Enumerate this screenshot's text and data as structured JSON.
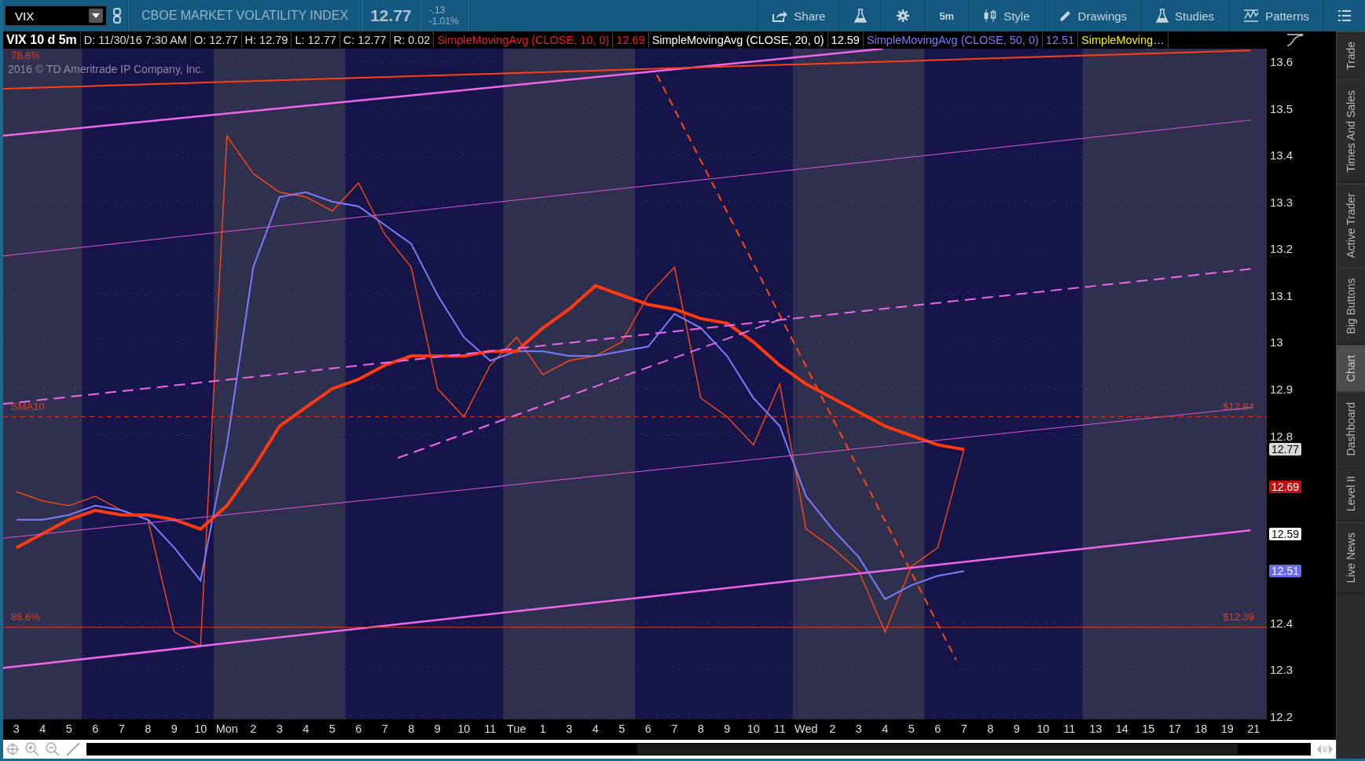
{
  "toolbar": {
    "symbol": "VIX",
    "description": "CBOE MARKET VOLATILITY INDEX",
    "last": "12.77",
    "change": "-.13",
    "change_percent": "-1.01%",
    "buttons": [
      {
        "kind": "share",
        "label": "Share"
      },
      {
        "kind": "flask"
      },
      {
        "kind": "gear"
      },
      {
        "kind": "text",
        "label": "5m"
      },
      {
        "kind": "style",
        "label": "Style"
      },
      {
        "kind": "drawings",
        "label": "Drawings"
      },
      {
        "kind": "studies",
        "label": "Studies"
      },
      {
        "kind": "patterns",
        "label": "Patterns"
      },
      {
        "kind": "menu"
      }
    ]
  },
  "legend": {
    "title": "VIX 10 d 5m",
    "fields": [
      "D: 11/30/16 7:30 AM",
      "O: 12.77",
      "H: 12.79",
      "L: 12.77",
      "C: 12.77",
      "R: 0.02"
    ],
    "studies": [
      {
        "label": "SimpleMovingAvg (CLOSE, 10, 0)",
        "value": "12.69"
      },
      {
        "label": "SimpleMovingAvg (CLOSE, 20, 0)",
        "value": "12.59"
      },
      {
        "label": "SimpleMovingAvg (CLOSE, 50, 0)",
        "value": "12.51"
      },
      {
        "label": "SimpleMoving…"
      }
    ]
  },
  "chart": {
    "copyright": "2016 © TD Ameritrade IP Company, Inc.",
    "top_level_label": "78.6%",
    "chart_data": {
      "type": "line",
      "categories": [
        "3",
        "4",
        "5",
        "6",
        "7",
        "8",
        "9",
        "10",
        "Mon",
        "2",
        "3",
        "4",
        "5",
        "6",
        "7",
        "8",
        "9",
        "10",
        "11",
        "Tue",
        "1",
        "3",
        "4",
        "5",
        "6",
        "7",
        "8",
        "9",
        "10",
        "11",
        "Wed",
        "2",
        "3",
        "4",
        "5",
        "6",
        "7",
        "8",
        "9",
        "10",
        "11",
        "13",
        "14",
        "15",
        "17",
        "18",
        "19",
        "21"
      ],
      "ylim": [
        12.193,
        13.627
      ],
      "yticks": [
        12.2,
        12.3,
        12.4,
        12.8,
        12.9,
        13,
        13.1,
        13.2,
        13.3,
        13.4,
        13.5,
        13.6
      ],
      "series": [
        {
          "color": "#ff4a12",
          "values": [
            12.68,
            12.66,
            12.65,
            12.67,
            12.64,
            12.62,
            12.38,
            12.35,
            13.44,
            13.36,
            13.32,
            13.31,
            13.28,
            13.34,
            13.23,
            13.16,
            12.9,
            12.84,
            12.95,
            13.01,
            12.93,
            12.96,
            12.97,
            13.0,
            13.1,
            13.16,
            12.88,
            12.84,
            12.78,
            12.91,
            12.6,
            12.56,
            12.51,
            12.38,
            12.52,
            12.56,
            12.77,
            null,
            null,
            null,
            null,
            null,
            null,
            null,
            null,
            null,
            null,
            null
          ]
        },
        {
          "color": "#7b7bff",
          "values": [
            12.62,
            12.62,
            12.63,
            12.65,
            12.64,
            12.62,
            12.56,
            12.49,
            12.78,
            13.16,
            13.31,
            13.32,
            13.3,
            13.29,
            13.25,
            13.21,
            13.1,
            13.01,
            12.96,
            12.98,
            12.98,
            12.97,
            12.97,
            12.98,
            12.99,
            13.06,
            13.03,
            12.97,
            12.88,
            12.82,
            12.67,
            12.6,
            12.54,
            12.45,
            12.48,
            12.5,
            12.51,
            null,
            null,
            null,
            null,
            null,
            null,
            null,
            null,
            null,
            null,
            null
          ]
        },
        {
          "color": "#ff3a10",
          "values": [
            12.56,
            12.59,
            12.62,
            12.64,
            12.63,
            12.63,
            12.62,
            12.6,
            12.65,
            12.73,
            12.82,
            12.86,
            12.9,
            12.92,
            12.95,
            12.97,
            12.97,
            12.97,
            12.98,
            12.98,
            13.03,
            13.07,
            13.12,
            13.1,
            13.08,
            13.07,
            13.05,
            13.04,
            13.0,
            12.95,
            12.91,
            12.88,
            12.85,
            12.82,
            12.8,
            12.78,
            12.77,
            null,
            null,
            null,
            null,
            null,
            null,
            null,
            null,
            null,
            null,
            null
          ]
        }
      ],
      "grid": true
    },
    "levels": [
      {
        "label": "SMA10",
        "price": "$12.84"
      },
      {
        "label": "88.6%",
        "price": "$12.39"
      }
    ],
    "price_tags": [
      "12.77",
      "12.69",
      "12.59",
      "12.51"
    ]
  },
  "side_tabs": [
    {
      "label": "Trade",
      "selected": false
    },
    {
      "label": "Times And Sales",
      "selected": false
    },
    {
      "label": "Active Trader",
      "selected": false
    },
    {
      "label": "Big Buttons",
      "selected": false
    },
    {
      "label": "Chart",
      "selected": true
    },
    {
      "label": "Dashboard",
      "selected": false
    },
    {
      "label": "Level II",
      "selected": false
    },
    {
      "label": "Live News",
      "selected": false
    }
  ]
}
